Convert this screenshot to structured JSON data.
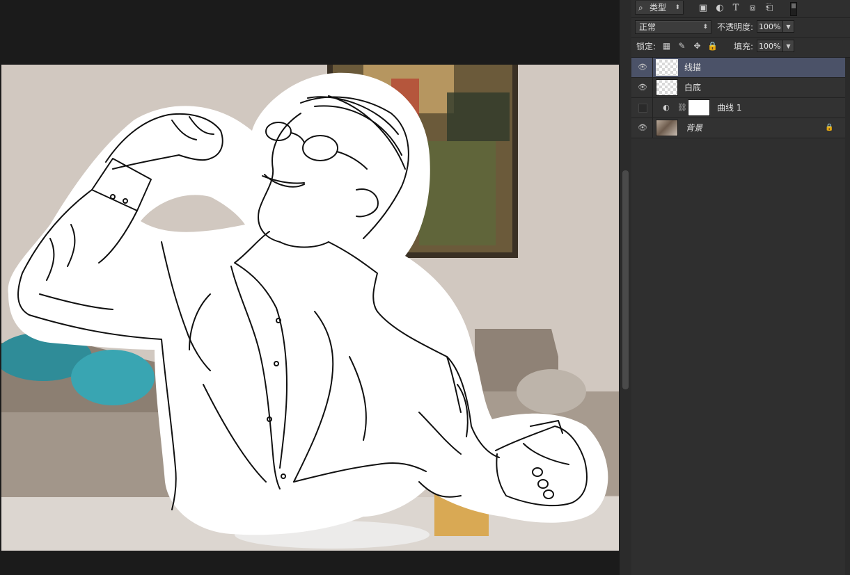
{
  "filter": {
    "kind_label": "类型",
    "search_icon": "search-icon",
    "filter_icons": [
      "image-filter-icon",
      "adjustment-filter-icon",
      "text-filter-icon",
      "shape-filter-icon",
      "smart-object-filter-icon"
    ]
  },
  "blend": {
    "mode": "正常",
    "opacity_label": "不透明度:",
    "opacity_value": "100%"
  },
  "lock": {
    "label": "锁定:",
    "fill_label": "填充:",
    "fill_value": "100%",
    "icons": [
      "lock-transparent-icon",
      "lock-paint-icon",
      "lock-move-icon",
      "lock-all-icon"
    ]
  },
  "layers": [
    {
      "name": "线描",
      "visible": true,
      "selected": true,
      "thumbnail": "transparent"
    },
    {
      "name": "白底",
      "visible": true,
      "selected": false,
      "thumbnail": "transparent"
    },
    {
      "name": "曲线 1",
      "visible": false,
      "selected": false,
      "thumbnail": "adjustment-mask"
    },
    {
      "name": "背景",
      "visible": true,
      "selected": false,
      "thumbnail": "photo",
      "locked": true
    }
  ],
  "colors": {
    "selected_layer": "#4b5268",
    "panel_bg": "#2f2f2f",
    "workspace_bg": "#1b1b1b"
  }
}
